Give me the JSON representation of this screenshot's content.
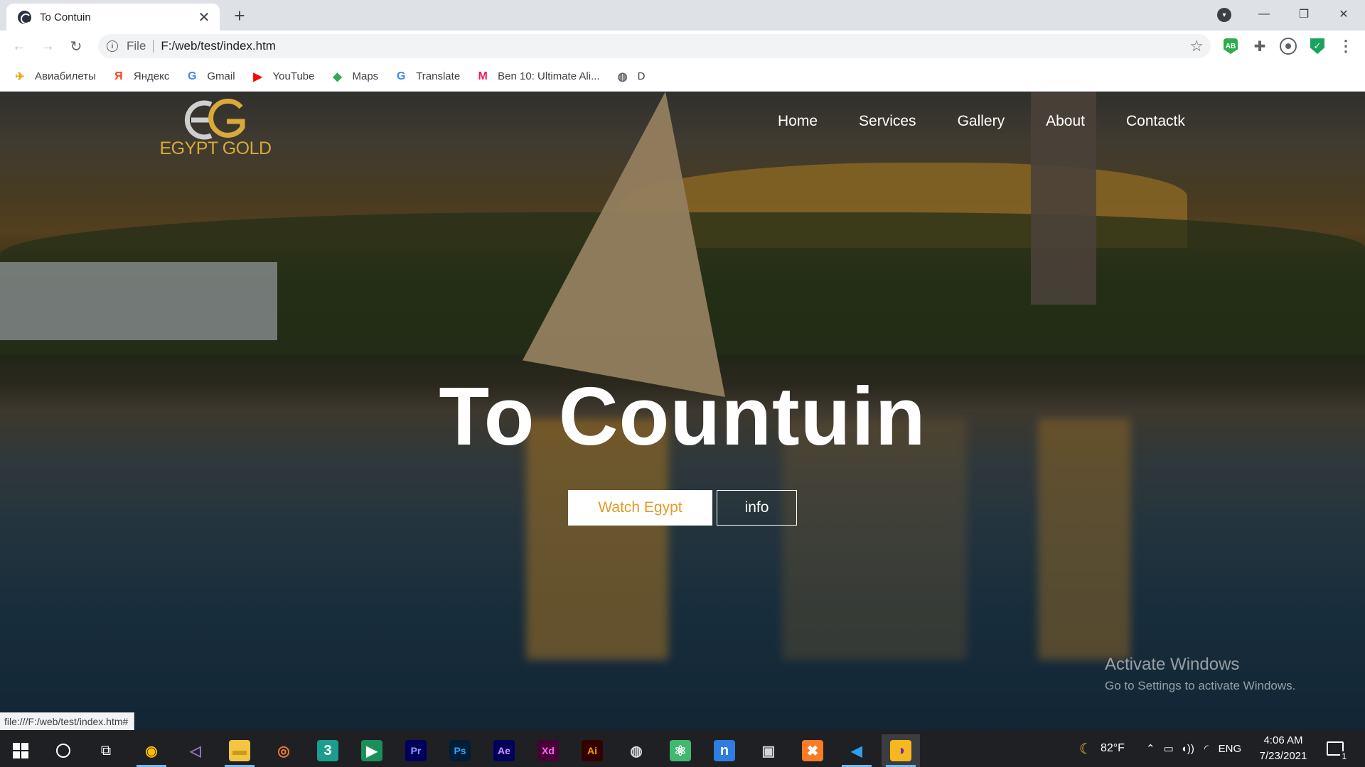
{
  "browser": {
    "tab_title": "To Contuin",
    "tab_close": "✕",
    "new_tab": "+",
    "url_scheme": "File",
    "url": "F:/web/test/index.htm",
    "window_controls": {
      "minimize": "—",
      "maximize": "❐",
      "close": "✕"
    }
  },
  "bookmarks": [
    {
      "label": "Авиабилеты",
      "icon": "airplane-icon",
      "glyph": "✈",
      "color": "#f0a30a"
    },
    {
      "label": "Яндекс",
      "icon": "yandex-icon",
      "glyph": "Я",
      "color": "#fc3f1d"
    },
    {
      "label": "Gmail",
      "icon": "google-icon",
      "glyph": "G",
      "color": "#4285f4"
    },
    {
      "label": "YouTube",
      "icon": "youtube-icon",
      "glyph": "▶",
      "color": "#ff0000"
    },
    {
      "label": "Maps",
      "icon": "maps-icon",
      "glyph": "◆",
      "color": "#34a853"
    },
    {
      "label": "Translate",
      "icon": "translate-icon",
      "glyph": "G",
      "color": "#4285f4"
    },
    {
      "label": "Ben 10: Ultimate Ali...",
      "icon": "ben10-icon",
      "glyph": "M",
      "color": "#e91e63"
    },
    {
      "label": "D",
      "icon": "globe-icon",
      "glyph": "◍",
      "color": "#5f6368"
    }
  ],
  "site": {
    "logo_text": "EGYPT GOLD",
    "nav": [
      "Home",
      "Services",
      "Gallery",
      "About",
      "Contactk"
    ],
    "hero_title": "To Countuin",
    "btn_watch": "Watch Egypt",
    "btn_info": "info",
    "accent_color": "#e59a24",
    "logo_gold": "#d9a93a"
  },
  "watermark": {
    "title": "Activate Windows",
    "subtitle": "Go to Settings to activate Windows."
  },
  "status_url": "file:///F:/web/test/index.htm#",
  "taskbar": {
    "apps": [
      {
        "name": "chrome-icon",
        "glyph": "◉",
        "bg": "transparent",
        "fg": "#fbbc05",
        "active": true
      },
      {
        "name": "visual-studio-icon",
        "glyph": "◁",
        "bg": "transparent",
        "fg": "#a074c4",
        "active": false
      },
      {
        "name": "file-explorer-icon",
        "glyph": "▬",
        "bg": "#f4c542",
        "fg": "#c89b1b",
        "active": true
      },
      {
        "name": "blender-icon",
        "glyph": "◎",
        "bg": "transparent",
        "fg": "#f5792a",
        "active": false
      },
      {
        "name": "3dsmax-icon",
        "glyph": "3",
        "bg": "#1d9d8e",
        "fg": "#ffffff",
        "active": false
      },
      {
        "name": "camtasia-icon",
        "glyph": "▶",
        "bg": "#1a8f5a",
        "fg": "#ffffff",
        "active": false
      },
      {
        "name": "premiere-icon",
        "glyph": "Pr",
        "bg": "#00005b",
        "fg": "#9999ff",
        "active": false
      },
      {
        "name": "photoshop-icon",
        "glyph": "Ps",
        "bg": "#001e36",
        "fg": "#31a8ff",
        "active": false
      },
      {
        "name": "after-effects-icon",
        "glyph": "Ae",
        "bg": "#00005b",
        "fg": "#d291ff",
        "active": false
      },
      {
        "name": "adobe-xd-icon",
        "glyph": "Xd",
        "bg": "#470137",
        "fg": "#ff61f6",
        "active": false
      },
      {
        "name": "illustrator-icon",
        "glyph": "Ai",
        "bg": "#330000",
        "fg": "#ff9a00",
        "active": false
      },
      {
        "name": "obs-icon",
        "glyph": "◍",
        "bg": "transparent",
        "fg": "#dddddd",
        "active": false
      },
      {
        "name": "atom-icon",
        "glyph": "⚛",
        "bg": "#40b870",
        "fg": "#ffffff",
        "active": false
      },
      {
        "name": "n-app-icon",
        "glyph": "n",
        "bg": "#2f7de1",
        "fg": "#ffffff",
        "active": false
      },
      {
        "name": "remote-desktop-icon",
        "glyph": "▣",
        "bg": "transparent",
        "fg": "#cfd8dc",
        "active": false
      },
      {
        "name": "xampp-icon",
        "glyph": "✖",
        "bg": "#fb7a24",
        "fg": "#ffffff",
        "active": false
      },
      {
        "name": "vscode-icon",
        "glyph": "◀",
        "bg": "transparent",
        "fg": "#2ea0f0",
        "active": true
      },
      {
        "name": "tor-browser-icon",
        "glyph": "◑",
        "bg": "#f5b81e",
        "fg": "#6f2ab8",
        "active": true
      }
    ],
    "weather": "82°F",
    "language": "ENG",
    "time": "4:06 AM",
    "date": "7/23/2021",
    "notifications": "1"
  }
}
